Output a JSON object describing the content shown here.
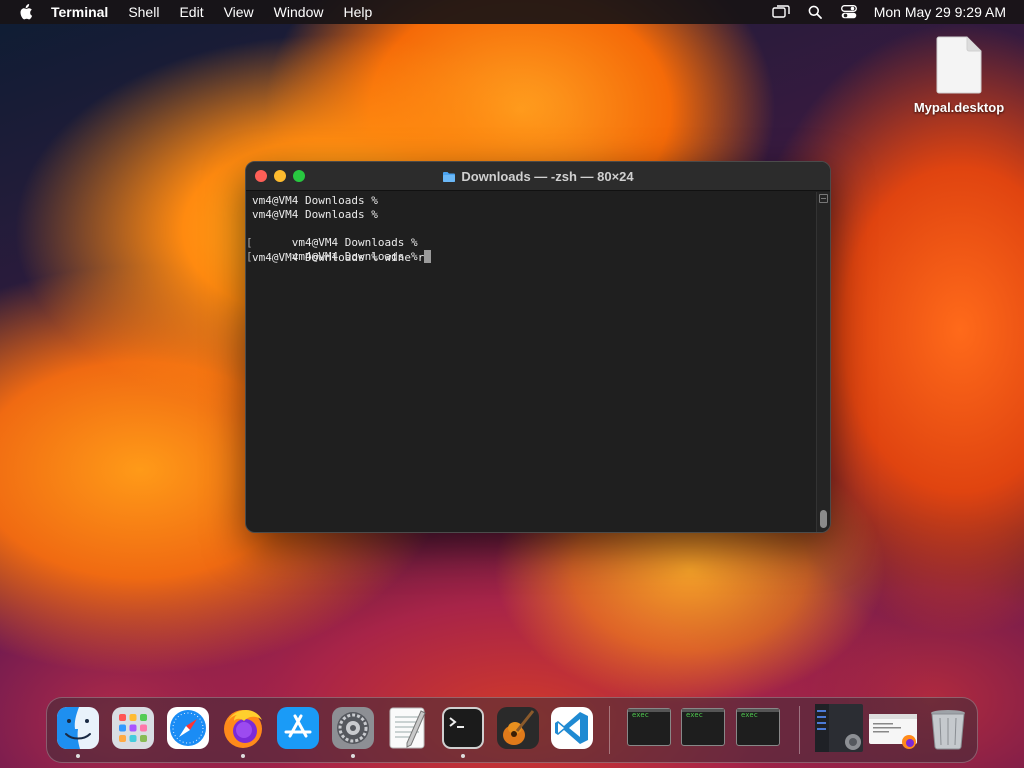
{
  "menubar": {
    "apple_icon": "apple-logo-icon",
    "app_name": "Terminal",
    "items": [
      "Shell",
      "Edit",
      "View",
      "Window",
      "Help"
    ],
    "status_icons": [
      "screen-mirroring-icon",
      "spotlight-search-icon",
      "control-center-icon"
    ],
    "clock": "Mon May 29  9:29 AM"
  },
  "desktop": {
    "file": {
      "name": "Mypal.desktop",
      "icon": "document-icon"
    }
  },
  "terminal": {
    "title": "Downloads — -zsh — 80×24",
    "title_icon": "folder-icon",
    "lines": [
      "vm4@VM4 Downloads %",
      "vm4@VM4 Downloads %",
      "vm4@VM4 Downloads %",
      "vm4@VM4 Downloads %",
      "vm4@VM4 Downloads % wine r"
    ],
    "colors": {
      "background": "#1f1f1f",
      "text": "#eaeaea"
    }
  },
  "dock": {
    "apps": [
      {
        "name": "Finder",
        "icon": "finder-icon",
        "running": true
      },
      {
        "name": "Launchpad",
        "icon": "launchpad-icon",
        "running": false
      },
      {
        "name": "Safari",
        "icon": "safari-icon",
        "running": false
      },
      {
        "name": "Firefox",
        "icon": "firefox-icon",
        "running": true
      },
      {
        "name": "App Store",
        "icon": "app-store-icon",
        "running": false
      },
      {
        "name": "System Settings",
        "icon": "system-settings-icon",
        "running": true
      },
      {
        "name": "TextEdit",
        "icon": "textedit-icon",
        "running": false
      },
      {
        "name": "Terminal",
        "icon": "terminal-icon",
        "running": true
      },
      {
        "name": "GarageBand",
        "icon": "garageband-icon",
        "running": false
      },
      {
        "name": "Visual Studio Code",
        "icon": "vscode-icon",
        "running": false
      }
    ],
    "exec_windows": [
      "exec",
      "exec",
      "exec"
    ],
    "trash": "trash-icon"
  }
}
